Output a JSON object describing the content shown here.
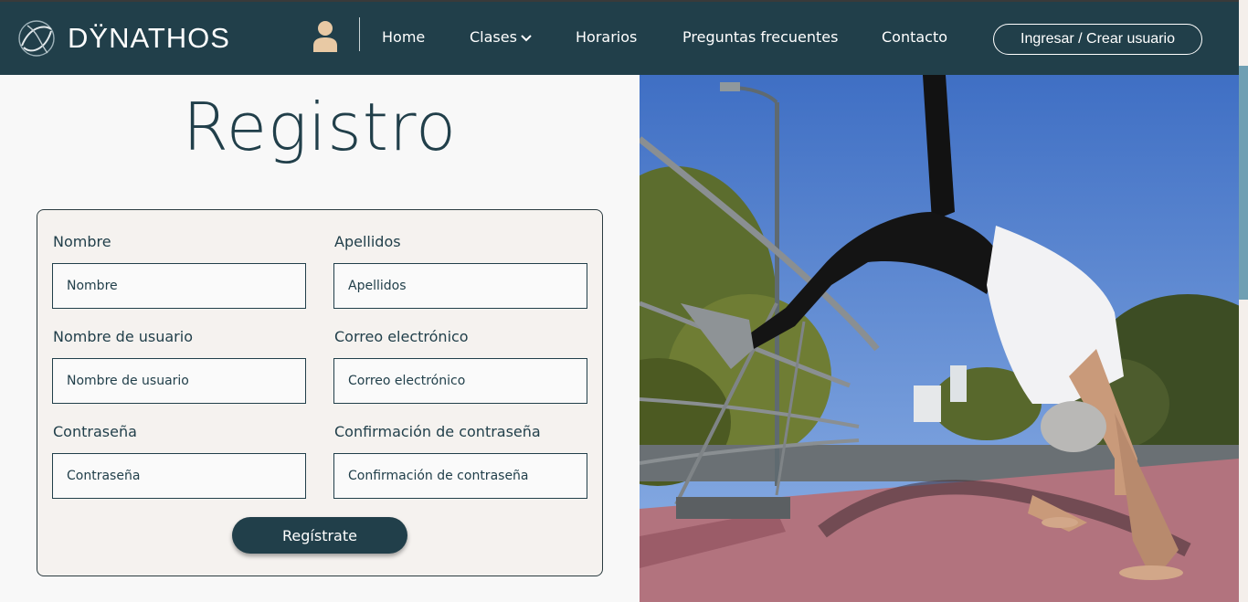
{
  "brand": {
    "name": "DŸNATHOS"
  },
  "nav": {
    "home": "Home",
    "clases": "Clases",
    "horarios": "Horarios",
    "faq": "Preguntas frecuentes",
    "contacto": "Contacto",
    "login": "Ingresar / Crear usuario"
  },
  "page": {
    "title": "Registro"
  },
  "form": {
    "nombre": {
      "label": "Nombre",
      "placeholder": "Nombre"
    },
    "apellidos": {
      "label": "Apellidos",
      "placeholder": "Apellidos"
    },
    "usuario": {
      "label": "Nombre de usuario",
      "placeholder": "Nombre de usuario"
    },
    "correo": {
      "label": "Correo electrónico",
      "placeholder": "Correo electrónico"
    },
    "contrasena": {
      "label": "Contraseña",
      "placeholder": "Contraseña"
    },
    "confirmacion": {
      "label": "Confirmación de contraseña",
      "placeholder": "Confirmación de contraseña"
    },
    "submit": "Regístrate"
  },
  "icons": {
    "logo": "dynathos-logo-icon",
    "user": "user-icon",
    "dropdown": "chevron-down-icon"
  },
  "colors": {
    "primary": "#213f4a",
    "avatar": "#e8c9a4",
    "card": "#f5f2ef"
  }
}
